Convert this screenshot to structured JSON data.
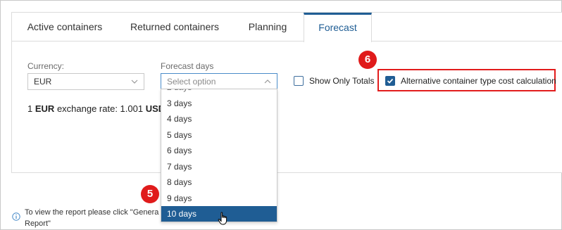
{
  "tabs": [
    {
      "label": "Active containers"
    },
    {
      "label": "Returned containers"
    },
    {
      "label": "Planning"
    },
    {
      "label": "Forecast",
      "active": true
    }
  ],
  "currency": {
    "label": "Currency:",
    "value": "EUR"
  },
  "forecast_days": {
    "label": "Forecast days",
    "placeholder": "Select option",
    "options": [
      "3 days",
      "4 days",
      "5 days",
      "6 days",
      "7 days",
      "8 days",
      "9 days",
      "10 days"
    ],
    "highlighted": "10 days"
  },
  "show_only_totals": {
    "label": "Show Only Totals",
    "checked": false
  },
  "alt_cost": {
    "label": "Alternative container type cost calculation",
    "checked": true
  },
  "rate": {
    "prefix": "1",
    "from": "EUR",
    "middle": "exchange rate: 1.001",
    "to": "USD"
  },
  "info": {
    "line1": "To view the report please click \"Genera",
    "line2": "Report\""
  },
  "badges": {
    "step5": "5",
    "step6": "6"
  },
  "colors": {
    "accent": "#1f5d94",
    "badge": "#e01b1b",
    "highlight_box": "#e21c1c"
  }
}
